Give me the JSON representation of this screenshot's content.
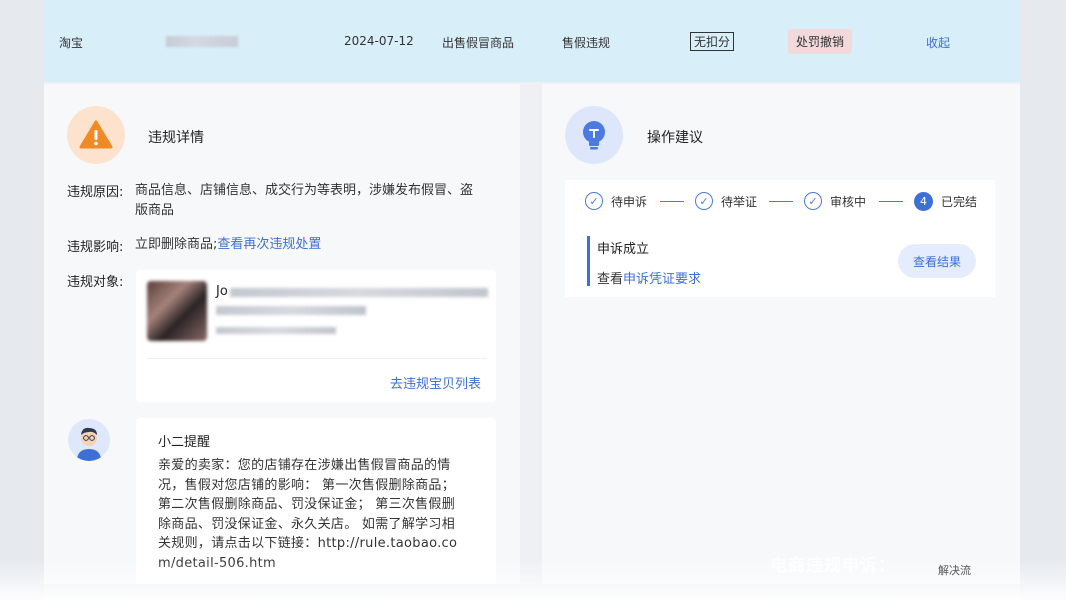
{
  "header": {
    "platform": "淘宝",
    "date": "2024-07-12",
    "violation_type": "出售假冒商品",
    "category": "售假违规",
    "deduction": "无扣分",
    "status": "处罚撤销",
    "collapse": "收起"
  },
  "violation_details": {
    "title": "违规详情",
    "reason_label": "违规原因:",
    "reason_value_line1": "商品信息、店铺信息、成交行为等表明，涉嫌发布假冒、盗",
    "reason_value_line2": "版商品",
    "impact_label": "违规影响:",
    "impact_value": "立即删除商品;",
    "impact_link": "查看再次违规处置",
    "target_label": "违规对象:",
    "product_name_prefix": "Jo",
    "product_list_link": "去违规宝贝列表"
  },
  "reminder": {
    "title": "小二提醒",
    "lines": [
      "亲爱的卖家：您的店铺存在涉嫌出售假冒商品的情",
      "况，售假对您店铺的影响： 第一次售假删除商品；",
      "第二次售假删除商品、罚没保证金； 第三次售假删",
      "除商品、罚没保证金、永久关店。 如需了解学习相",
      "关规则，请点击以下链接：http://rule.taobao.co",
      "m/detail-506.htm"
    ]
  },
  "suggestions": {
    "title": "操作建议",
    "steps": [
      {
        "label": "待申诉",
        "state": "done"
      },
      {
        "label": "待举证",
        "state": "done"
      },
      {
        "label": "审核中",
        "state": "done"
      },
      {
        "label": "已完结",
        "state": "current",
        "number": "4"
      }
    ],
    "result_title": "申诉成立",
    "result_prefix": "查看",
    "result_link": "申诉凭证要求",
    "result_button": "查看结果"
  },
  "overlay": {
    "watermark": "电商违规申诉：",
    "corner_text": "解决流"
  },
  "colors": {
    "accent": "#3d6fd6",
    "header_bg": "#d8eef9",
    "warning": "#f08a24"
  },
  "icons": [
    "warning-icon",
    "lightbulb-icon",
    "check-circle-icon",
    "avatar-icon"
  ]
}
